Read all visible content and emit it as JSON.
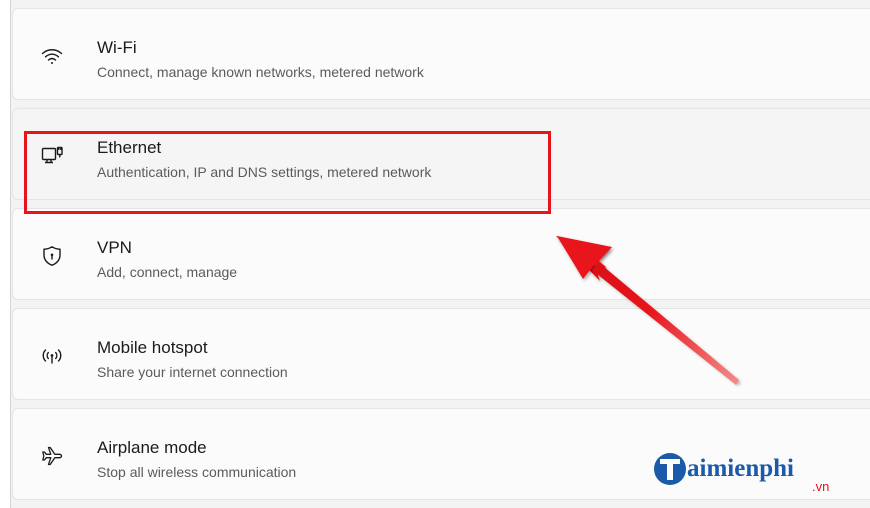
{
  "settings": {
    "items": [
      {
        "icon": "wifi-icon",
        "title": "Wi-Fi",
        "subtitle": "Connect, manage known networks, metered network"
      },
      {
        "icon": "ethernet-icon",
        "title": "Ethernet",
        "subtitle": "Authentication, IP and DNS settings, metered network"
      },
      {
        "icon": "vpn-shield-icon",
        "title": "VPN",
        "subtitle": "Add, connect, manage"
      },
      {
        "icon": "hotspot-icon",
        "title": "Mobile hotspot",
        "subtitle": "Share your internet connection"
      },
      {
        "icon": "airplane-icon",
        "title": "Airplane mode",
        "subtitle": "Stop all wireless communication"
      }
    ]
  },
  "annotation": {
    "highlighted_item": "Ethernet",
    "color": "#e8141b"
  },
  "watermark": {
    "brand_rest": "aimienphi",
    "brand_initial": "T",
    "suffix": ".vn",
    "brand_color": "#1a5aa8",
    "suffix_color": "#e8141b"
  }
}
